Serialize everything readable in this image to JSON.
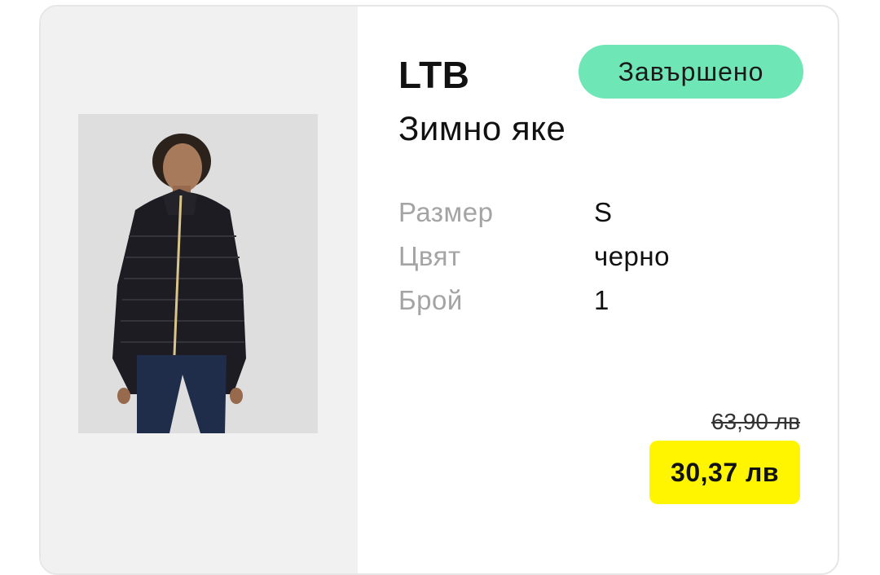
{
  "product": {
    "brand": "LTB",
    "name": "Зимно яке",
    "image_icon": "product-photo-jacket"
  },
  "status": {
    "label": "Завършено",
    "color": "#6fe6b6"
  },
  "attributes": [
    {
      "label": "Размер",
      "value": "S"
    },
    {
      "label": "Цвят",
      "value": "черно"
    },
    {
      "label": "Брой",
      "value": "1"
    }
  ],
  "pricing": {
    "original": "63,90 лв",
    "current": "30,37 лв",
    "highlight_color": "#fff500"
  }
}
